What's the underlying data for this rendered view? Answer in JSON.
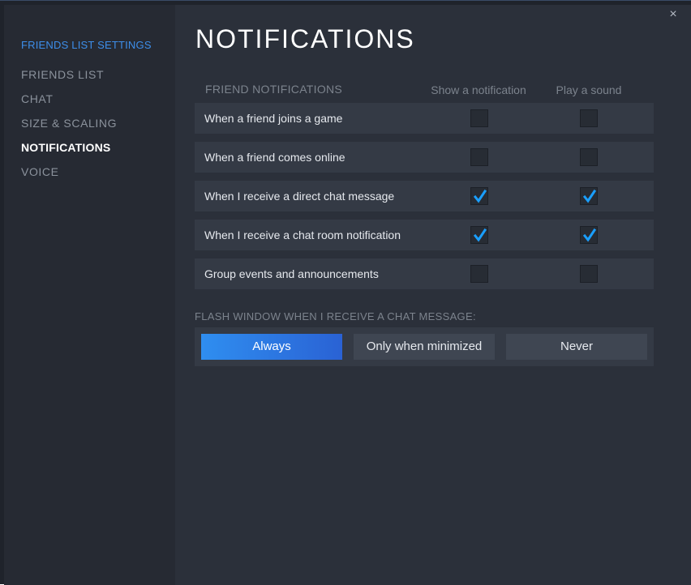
{
  "sidebar": {
    "heading": "FRIENDS LIST SETTINGS",
    "items": [
      {
        "label": "FRIENDS LIST",
        "active": false
      },
      {
        "label": "CHAT",
        "active": false
      },
      {
        "label": "SIZE & SCALING",
        "active": false
      },
      {
        "label": "NOTIFICATIONS",
        "active": true
      },
      {
        "label": "VOICE",
        "active": false
      }
    ]
  },
  "main": {
    "close_glyph": "×",
    "title": "NOTIFICATIONS",
    "friend_notifications": {
      "section_label": "FRIEND NOTIFICATIONS",
      "columns": [
        "Show a notification",
        "Play a sound"
      ],
      "rows": [
        {
          "label": "When a friend joins a game",
          "show": false,
          "sound": false
        },
        {
          "label": "When a friend comes online",
          "show": false,
          "sound": false
        },
        {
          "label": "When I receive a direct chat message",
          "show": true,
          "sound": true
        },
        {
          "label": "When I receive a chat room notification",
          "show": true,
          "sound": true
        },
        {
          "label": "Group events and announcements",
          "show": false,
          "sound": false
        }
      ]
    },
    "flash_window": {
      "label": "FLASH WINDOW WHEN I RECEIVE A CHAT MESSAGE:",
      "options": [
        "Always",
        "Only when minimized",
        "Never"
      ],
      "selected": "Always"
    }
  },
  "colors": {
    "accent": "#3d8eea",
    "check": "#1a9fff",
    "selected_button": "#2f8ef0"
  },
  "icons": {
    "close": "close-icon",
    "check": "checkmark-icon"
  }
}
